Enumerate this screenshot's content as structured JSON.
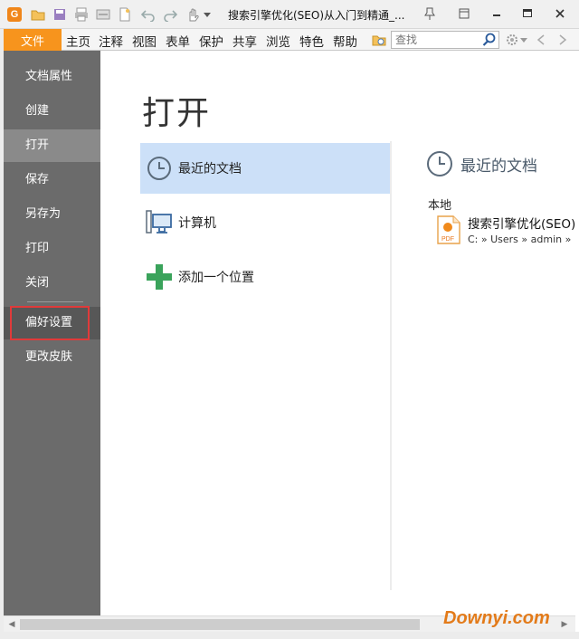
{
  "window": {
    "title": "搜索引擎优化(SEO)从入门到精通_...",
    "app_logo": "G"
  },
  "menubar": {
    "file_tab": "文件",
    "items": [
      "主页",
      "注释",
      "视图",
      "表单",
      "保护",
      "共享",
      "浏览",
      "特色",
      "帮助"
    ],
    "search_placeholder": "查找"
  },
  "sidebar": {
    "items": [
      {
        "label": "文档属性"
      },
      {
        "label": "创建"
      },
      {
        "label": "打开"
      },
      {
        "label": "保存"
      },
      {
        "label": "另存为"
      },
      {
        "label": "打印"
      },
      {
        "label": "关闭"
      },
      {
        "label": "偏好设置"
      },
      {
        "label": "更改皮肤"
      }
    ],
    "active_item": "打开",
    "highlighted_item": "偏好设置"
  },
  "main": {
    "title": "打开",
    "locations": [
      {
        "label": "最近的文档",
        "icon": "clock-icon"
      },
      {
        "label": "计算机",
        "icon": "computer-icon"
      },
      {
        "label": "添加一个位置",
        "icon": "plus-icon"
      }
    ],
    "recent": {
      "header": "最近的文档",
      "section_label": "本地",
      "files": [
        {
          "name": "搜索引擎优化(SEO)",
          "path": "C: » Users » admin »",
          "icon": "pdf-file-icon"
        }
      ]
    }
  },
  "watermark": "Downyi.com",
  "colors": {
    "accent_orange": "#f7941d",
    "sidebar_bg": "#6b6b6b",
    "selected_bg": "#cce0f8",
    "highlight_red": "#e03a3a",
    "plus_green": "#3aa35b"
  }
}
